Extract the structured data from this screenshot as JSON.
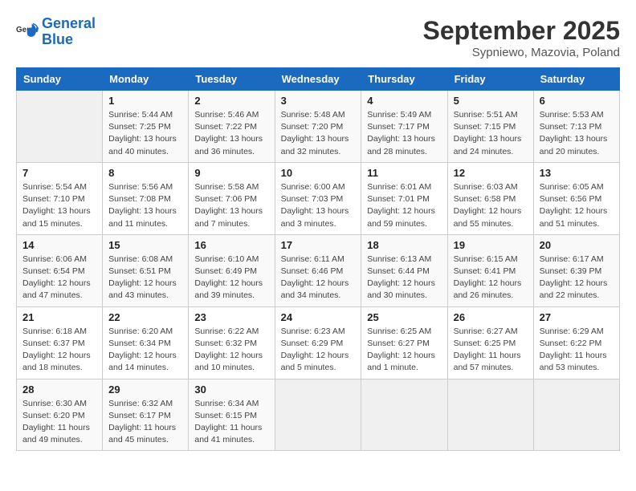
{
  "logo": {
    "text_general": "General",
    "text_blue": "Blue"
  },
  "title": "September 2025",
  "location": "Sypniewo, Mazovia, Poland",
  "days_of_week": [
    "Sunday",
    "Monday",
    "Tuesday",
    "Wednesday",
    "Thursday",
    "Friday",
    "Saturday"
  ],
  "weeks": [
    [
      {
        "num": "",
        "info": ""
      },
      {
        "num": "1",
        "info": "Sunrise: 5:44 AM\nSunset: 7:25 PM\nDaylight: 13 hours\nand 40 minutes."
      },
      {
        "num": "2",
        "info": "Sunrise: 5:46 AM\nSunset: 7:22 PM\nDaylight: 13 hours\nand 36 minutes."
      },
      {
        "num": "3",
        "info": "Sunrise: 5:48 AM\nSunset: 7:20 PM\nDaylight: 13 hours\nand 32 minutes."
      },
      {
        "num": "4",
        "info": "Sunrise: 5:49 AM\nSunset: 7:17 PM\nDaylight: 13 hours\nand 28 minutes."
      },
      {
        "num": "5",
        "info": "Sunrise: 5:51 AM\nSunset: 7:15 PM\nDaylight: 13 hours\nand 24 minutes."
      },
      {
        "num": "6",
        "info": "Sunrise: 5:53 AM\nSunset: 7:13 PM\nDaylight: 13 hours\nand 20 minutes."
      }
    ],
    [
      {
        "num": "7",
        "info": "Sunrise: 5:54 AM\nSunset: 7:10 PM\nDaylight: 13 hours\nand 15 minutes."
      },
      {
        "num": "8",
        "info": "Sunrise: 5:56 AM\nSunset: 7:08 PM\nDaylight: 13 hours\nand 11 minutes."
      },
      {
        "num": "9",
        "info": "Sunrise: 5:58 AM\nSunset: 7:06 PM\nDaylight: 13 hours\nand 7 minutes."
      },
      {
        "num": "10",
        "info": "Sunrise: 6:00 AM\nSunset: 7:03 PM\nDaylight: 13 hours\nand 3 minutes."
      },
      {
        "num": "11",
        "info": "Sunrise: 6:01 AM\nSunset: 7:01 PM\nDaylight: 12 hours\nand 59 minutes."
      },
      {
        "num": "12",
        "info": "Sunrise: 6:03 AM\nSunset: 6:58 PM\nDaylight: 12 hours\nand 55 minutes."
      },
      {
        "num": "13",
        "info": "Sunrise: 6:05 AM\nSunset: 6:56 PM\nDaylight: 12 hours\nand 51 minutes."
      }
    ],
    [
      {
        "num": "14",
        "info": "Sunrise: 6:06 AM\nSunset: 6:54 PM\nDaylight: 12 hours\nand 47 minutes."
      },
      {
        "num": "15",
        "info": "Sunrise: 6:08 AM\nSunset: 6:51 PM\nDaylight: 12 hours\nand 43 minutes."
      },
      {
        "num": "16",
        "info": "Sunrise: 6:10 AM\nSunset: 6:49 PM\nDaylight: 12 hours\nand 39 minutes."
      },
      {
        "num": "17",
        "info": "Sunrise: 6:11 AM\nSunset: 6:46 PM\nDaylight: 12 hours\nand 34 minutes."
      },
      {
        "num": "18",
        "info": "Sunrise: 6:13 AM\nSunset: 6:44 PM\nDaylight: 12 hours\nand 30 minutes."
      },
      {
        "num": "19",
        "info": "Sunrise: 6:15 AM\nSunset: 6:41 PM\nDaylight: 12 hours\nand 26 minutes."
      },
      {
        "num": "20",
        "info": "Sunrise: 6:17 AM\nSunset: 6:39 PM\nDaylight: 12 hours\nand 22 minutes."
      }
    ],
    [
      {
        "num": "21",
        "info": "Sunrise: 6:18 AM\nSunset: 6:37 PM\nDaylight: 12 hours\nand 18 minutes."
      },
      {
        "num": "22",
        "info": "Sunrise: 6:20 AM\nSunset: 6:34 PM\nDaylight: 12 hours\nand 14 minutes."
      },
      {
        "num": "23",
        "info": "Sunrise: 6:22 AM\nSunset: 6:32 PM\nDaylight: 12 hours\nand 10 minutes."
      },
      {
        "num": "24",
        "info": "Sunrise: 6:23 AM\nSunset: 6:29 PM\nDaylight: 12 hours\nand 5 minutes."
      },
      {
        "num": "25",
        "info": "Sunrise: 6:25 AM\nSunset: 6:27 PM\nDaylight: 12 hours\nand 1 minute."
      },
      {
        "num": "26",
        "info": "Sunrise: 6:27 AM\nSunset: 6:25 PM\nDaylight: 11 hours\nand 57 minutes."
      },
      {
        "num": "27",
        "info": "Sunrise: 6:29 AM\nSunset: 6:22 PM\nDaylight: 11 hours\nand 53 minutes."
      }
    ],
    [
      {
        "num": "28",
        "info": "Sunrise: 6:30 AM\nSunset: 6:20 PM\nDaylight: 11 hours\nand 49 minutes."
      },
      {
        "num": "29",
        "info": "Sunrise: 6:32 AM\nSunset: 6:17 PM\nDaylight: 11 hours\nand 45 minutes."
      },
      {
        "num": "30",
        "info": "Sunrise: 6:34 AM\nSunset: 6:15 PM\nDaylight: 11 hours\nand 41 minutes."
      },
      {
        "num": "",
        "info": ""
      },
      {
        "num": "",
        "info": ""
      },
      {
        "num": "",
        "info": ""
      },
      {
        "num": "",
        "info": ""
      }
    ]
  ]
}
